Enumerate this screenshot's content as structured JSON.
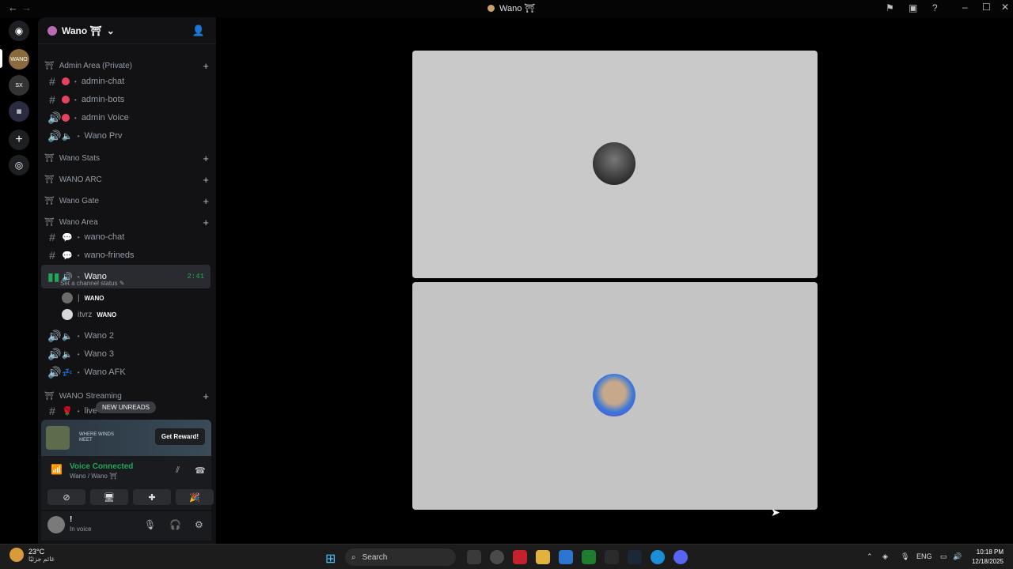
{
  "titlebar": {
    "title": "Wano ⛩"
  },
  "server": {
    "name": "Wano ⛩"
  },
  "categories": [
    {
      "label": "Admin Area (Private)"
    },
    {
      "label": "Wano Stats"
    },
    {
      "label": "WANO ARC"
    },
    {
      "label": "Wano Gate"
    },
    {
      "label": "Wano Area"
    },
    {
      "label": "WANO Streaming"
    }
  ],
  "channels": [
    {
      "label": "admin-chat",
      "color": "#e8435e"
    },
    {
      "label": "admin-bots",
      "color": "#e8435e"
    },
    {
      "label": "admin Voice",
      "color": "#e8435e"
    },
    {
      "label": "Wano Prv"
    },
    {
      "label": "wano-chat"
    },
    {
      "label": "wano-frineds"
    },
    {
      "label": "Wano",
      "timer": "2:41"
    },
    {
      "label": "Wano 2"
    },
    {
      "label": "Wano 3"
    },
    {
      "label": "Wano AFK"
    },
    {
      "label": "live-"
    }
  ],
  "voice": {
    "status_hint": "Set a channel status ✎",
    "users": [
      {
        "name": "|",
        "tag": "WANO"
      },
      {
        "name": "itvrz",
        "tag": "WANO"
      }
    ]
  },
  "new_unreads": "NEW UNREADS",
  "promo": {
    "logo": "WHERE WINDS MEET",
    "button": "Get Reward!"
  },
  "voice_connected": {
    "title": "Voice Connected",
    "subtitle": "Wano / Wano ⛩"
  },
  "user_panel": {
    "name": "!",
    "status": "In voice"
  },
  "taskbar": {
    "temp": "23°C",
    "location": "غائم جزئيًا",
    "search": "Search",
    "lang": "ENG",
    "time": "10:18 PM",
    "date": "12/18/2025"
  },
  "colors": {
    "accent": "#23a55a",
    "tile": "#c9c9c9"
  }
}
